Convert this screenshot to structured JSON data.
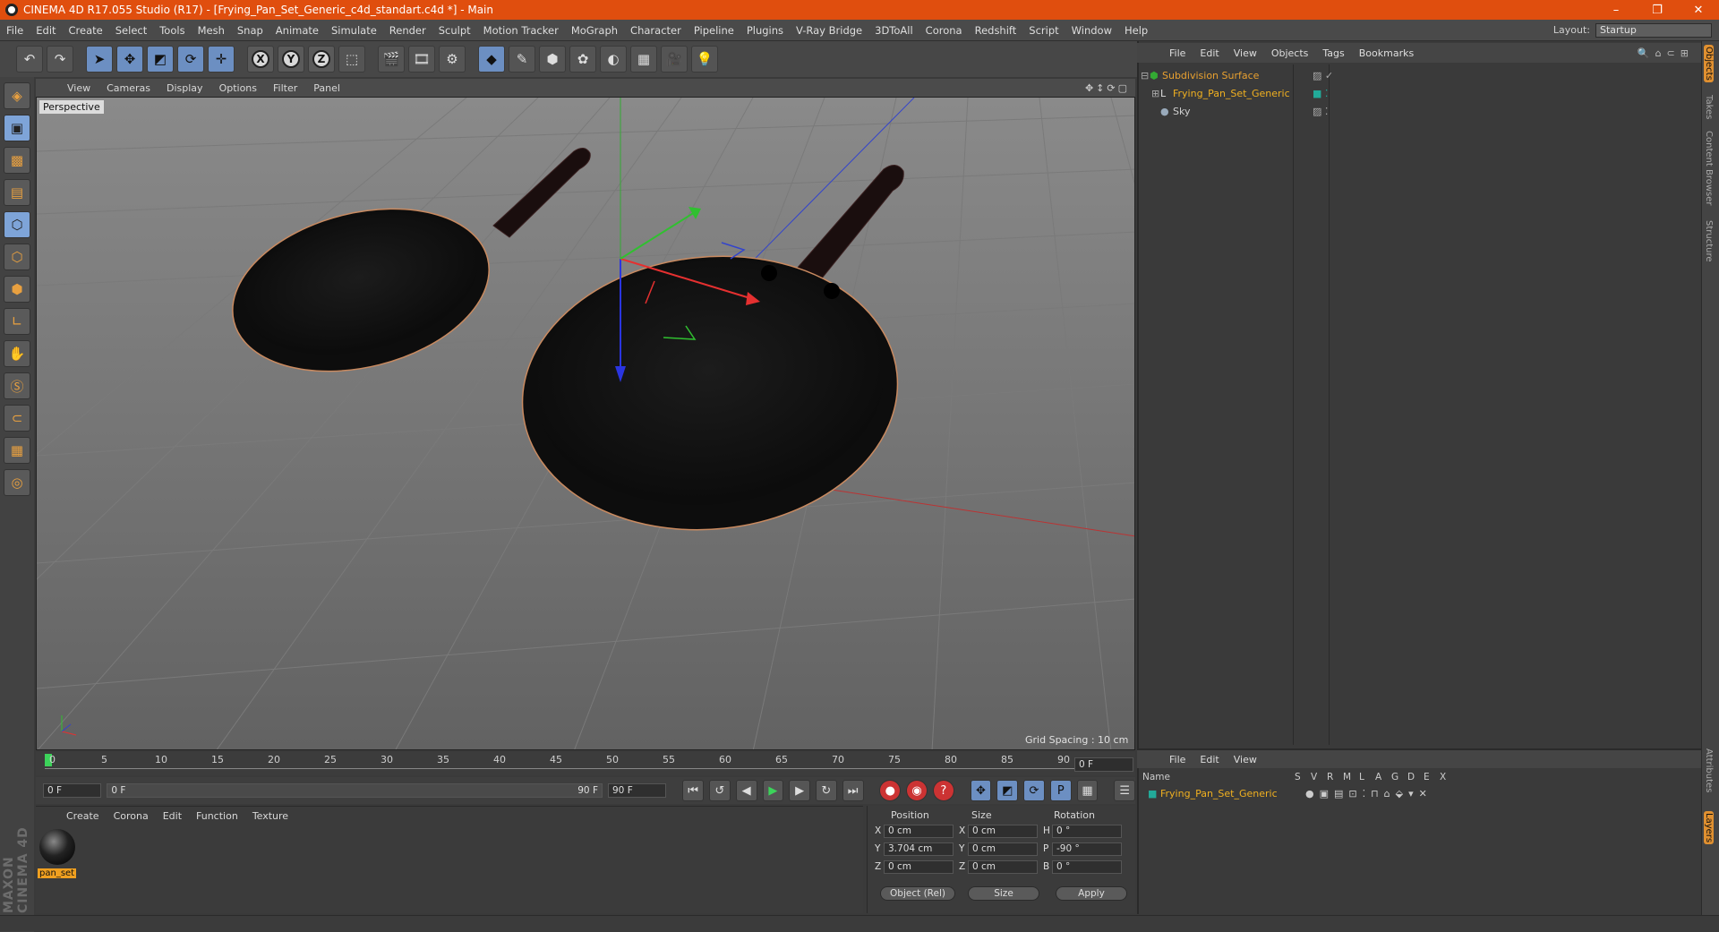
{
  "window": {
    "title": "CINEMA 4D R17.055 Studio (R17) - [Frying_Pan_Set_Generic_c4d_standart.c4d *] - Main",
    "controls": [
      "–",
      "❐",
      "✕"
    ]
  },
  "menubar": {
    "items": [
      "File",
      "Edit",
      "Create",
      "Select",
      "Tools",
      "Mesh",
      "Snap",
      "Animate",
      "Simulate",
      "Render",
      "Sculpt",
      "Motion Tracker",
      "MoGraph",
      "Character",
      "Pipeline",
      "Plugins",
      "V-Ray Bridge",
      "3DToAll",
      "Corona",
      "Redshift",
      "Script",
      "Window",
      "Help"
    ],
    "layout_label": "Layout:",
    "layout_value": "Startup"
  },
  "viewport": {
    "menu": [
      "View",
      "Cameras",
      "Display",
      "Options",
      "Filter",
      "Panel"
    ],
    "label": "Perspective",
    "grid_spacing": "Grid Spacing : 10 cm"
  },
  "timeline": {
    "ticks": [
      "0",
      "5",
      "10",
      "15",
      "20",
      "25",
      "30",
      "35",
      "40",
      "45",
      "50",
      "55",
      "60",
      "65",
      "70",
      "75",
      "80",
      "85",
      "90"
    ],
    "current_frame": "0 F",
    "start_field": "0 F",
    "range_start": "0 F",
    "range_end": "90 F",
    "end_field": "90 F"
  },
  "material_manager": {
    "menu": [
      "Create",
      "Corona",
      "Edit",
      "Function",
      "Texture"
    ],
    "materials": [
      {
        "name": "pan_set"
      }
    ]
  },
  "coordinates": {
    "headers": [
      "Position",
      "Size",
      "Rotation"
    ],
    "rows": [
      {
        "axis": "X",
        "pos": "0 cm",
        "size_axis": "X",
        "size": "0 cm",
        "rot_axis": "H",
        "rot": "0 °"
      },
      {
        "axis": "Y",
        "pos": "3.704 cm",
        "size_axis": "Y",
        "size": "0 cm",
        "rot_axis": "P",
        "rot": "-90 °"
      },
      {
        "axis": "Z",
        "pos": "0 cm",
        "size_axis": "Z",
        "size": "0 cm",
        "rot_axis": "B",
        "rot": "0 °"
      }
    ],
    "mode_dropdown": "Object (Rel)",
    "size_dropdown": "Size",
    "apply_label": "Apply"
  },
  "object_manager": {
    "menu": [
      "File",
      "Edit",
      "View",
      "Objects",
      "Tags",
      "Bookmarks"
    ],
    "objects": [
      {
        "name": "Subdivision Surface",
        "color": "#e8a030"
      },
      {
        "name": "Frying_Pan_Set_Generic",
        "color": "#f0b020"
      },
      {
        "name": "Sky",
        "color": "#cfcfcf"
      }
    ]
  },
  "layer_manager": {
    "menu": [
      "File",
      "Edit",
      "View"
    ],
    "columns": [
      "Name",
      "S",
      "V",
      "R",
      "M",
      "L",
      "A",
      "G",
      "D",
      "E",
      "X"
    ],
    "layers": [
      {
        "name": "Frying_Pan_Set_Generic"
      }
    ]
  },
  "right_tabs": [
    "Objects",
    "Takes",
    "Content Browser",
    "Structure",
    "Attributes",
    "Layers"
  ],
  "brand": "MAXON CINEMA 4D",
  "colors": {
    "accent": "#e04e0e",
    "selection": "#f0a020",
    "axis_x": "#e53030",
    "axis_y": "#30c030",
    "axis_z": "#3050e0"
  }
}
